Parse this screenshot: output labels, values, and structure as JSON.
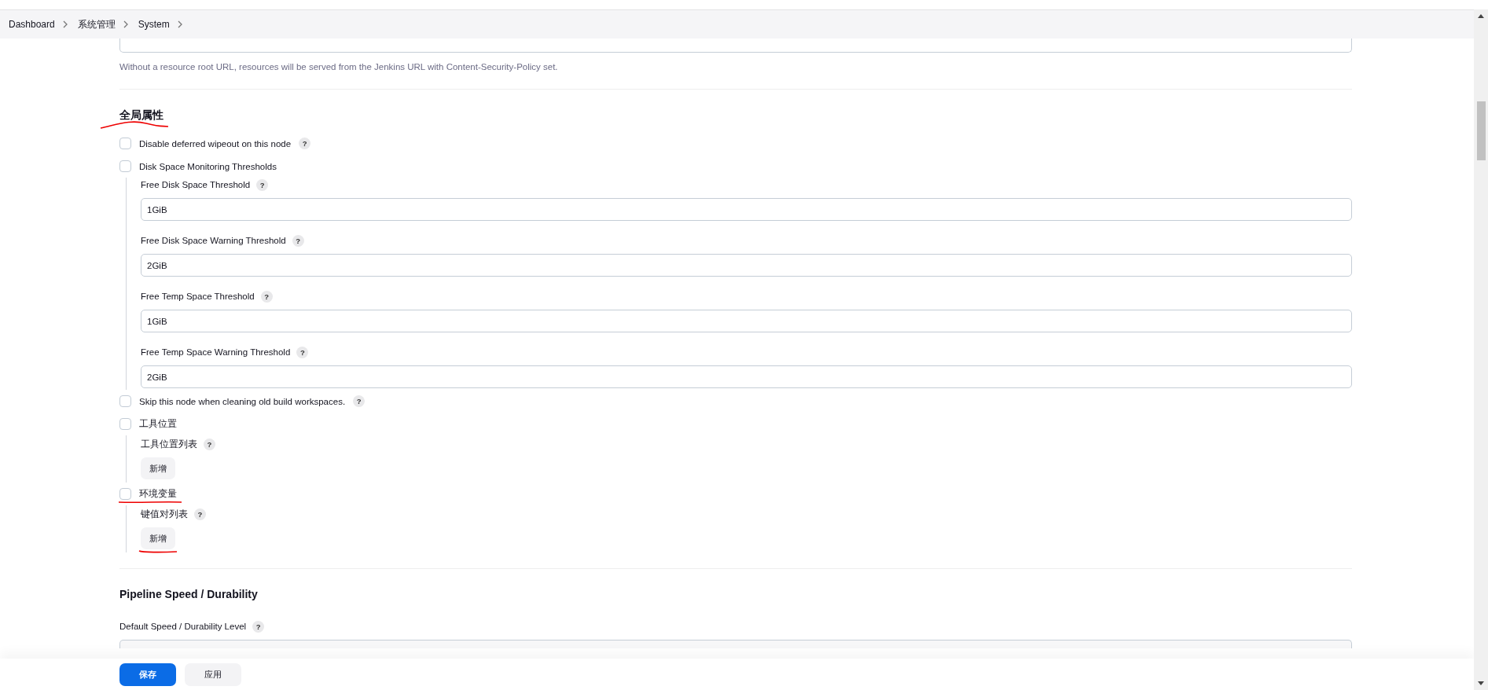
{
  "breadcrumbs": [
    {
      "label": "Dashboard"
    },
    {
      "label": "系统管理"
    },
    {
      "label": "System"
    }
  ],
  "resource_root": {
    "help_text": "Without a resource root URL, resources will be served from the Jenkins URL with Content-Security-Policy set."
  },
  "global_properties": {
    "title": "全局属性",
    "options": [
      {
        "kind": "plain",
        "label": "Disable deferred wipeout on this node",
        "checked": false,
        "help": "?"
      },
      {
        "kind": "fields",
        "label": "Disk Space Monitoring Thresholds",
        "checked": false,
        "fields": [
          {
            "label": "Free Disk Space Threshold",
            "help": "?",
            "value": "1GiB"
          },
          {
            "label": "Free Disk Space Warning Threshold",
            "help": "?",
            "value": "2GiB"
          },
          {
            "label": "Free Temp Space Threshold",
            "help": "?",
            "value": "1GiB"
          },
          {
            "label": "Free Temp Space Warning Threshold",
            "help": "?",
            "value": "2GiB"
          }
        ]
      },
      {
        "kind": "plain",
        "label": "Skip this node when cleaning old build workspaces.",
        "checked": false,
        "help": "?"
      },
      {
        "kind": "list",
        "label": "工具位置",
        "checked": false,
        "list": {
          "label": "工具位置列表",
          "help": "?",
          "button": "新增"
        }
      },
      {
        "kind": "list",
        "label": "环境变量",
        "checked": false,
        "list": {
          "label": "键值对列表",
          "help": "?",
          "button": "新增"
        }
      }
    ]
  },
  "pipeline": {
    "title": "Pipeline Speed / Durability",
    "field_label": "Default Speed / Durability Level",
    "help": "?"
  },
  "buttons": [
    {
      "label": "保存",
      "kind": "primary"
    },
    {
      "label": "应用",
      "kind": "secondary"
    }
  ]
}
